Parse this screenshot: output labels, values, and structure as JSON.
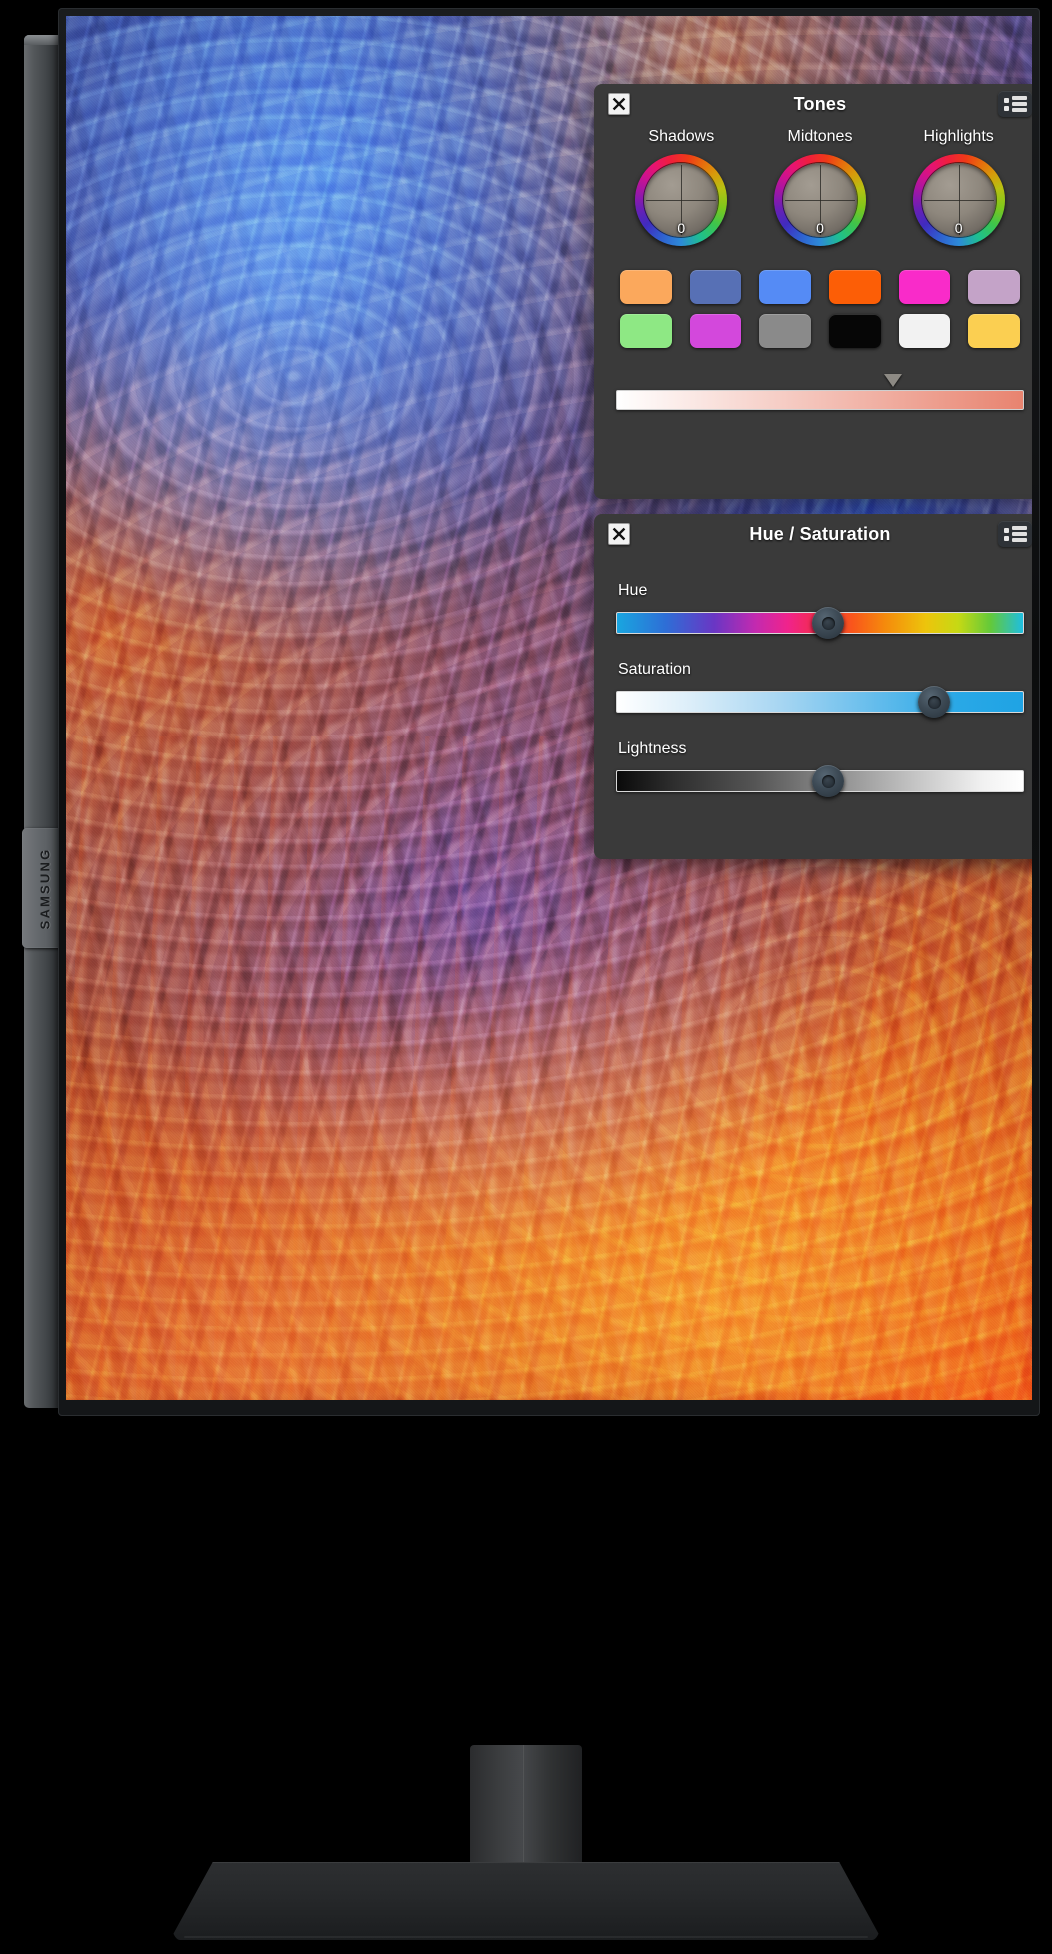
{
  "device": {
    "brand": "SAMSUNG"
  },
  "tones_panel": {
    "title": "Tones",
    "close_icon": "close-icon",
    "menu_icon": "list-menu-icon",
    "wheels": [
      {
        "label": "Shadows",
        "value": "0"
      },
      {
        "label": "Midtones",
        "value": "0"
      },
      {
        "label": "Highlights",
        "value": "0"
      }
    ],
    "swatches": [
      {
        "name": "swatch-orange-light",
        "color": "#FBA85C"
      },
      {
        "name": "swatch-slate-blue",
        "color": "#5770B5"
      },
      {
        "name": "swatch-bright-blue",
        "color": "#558BF5"
      },
      {
        "name": "swatch-orange",
        "color": "#FC5E06"
      },
      {
        "name": "swatch-magenta",
        "color": "#F92BC9"
      },
      {
        "name": "swatch-mauve",
        "color": "#C4A3C8"
      },
      {
        "name": "swatch-green-light",
        "color": "#8EE884"
      },
      {
        "name": "swatch-violet",
        "color": "#D348DC"
      },
      {
        "name": "swatch-gray",
        "color": "#8A8A8A"
      },
      {
        "name": "swatch-black",
        "color": "#060606"
      },
      {
        "name": "swatch-white",
        "color": "#F2F2F2"
      },
      {
        "name": "swatch-yellow",
        "color": "#FBCF51"
      }
    ],
    "strip": {
      "name": "tone-gradient-strip",
      "from_color": "#FFFFFF",
      "to_color": "#E8836F",
      "marker_position_percent": 68
    }
  },
  "hue_saturation_panel": {
    "title": "Hue / Saturation",
    "close_icon": "close-icon",
    "menu_icon": "list-menu-icon",
    "sliders": [
      {
        "name": "hue-slider",
        "label": "Hue",
        "position_percent": 52,
        "gradient": "linear-gradient(90deg,#19A6E0 0%,#2E6ED6 12%,#6A36C4 24%,#C22AB0 34%,#F0238C 42%,#F42D47 50%,#F9561B 58%,#F58A0C 66%,#EDC40C 76%,#C6D914 84%,#63C93A 92%,#1FBEE0 100%)"
      },
      {
        "name": "saturation-slider",
        "label": "Saturation",
        "position_percent": 78,
        "gradient": "linear-gradient(90deg,#FFFFFF 0%,#DCEEF9 18%,#A8D6F2 40%,#63BCEC 64%,#29A8E6 84%,#1FA3E4 100%)"
      },
      {
        "name": "lightness-slider",
        "label": "Lightness",
        "position_percent": 52,
        "gradient": "linear-gradient(90deg,#0A0A0A 0%,#2E2E2E 14%,#555555 34%,#8E8E8E 54%,#C6C6C6 74%,#F1F1F1 90%,#FFFFFF 100%)"
      }
    ]
  }
}
